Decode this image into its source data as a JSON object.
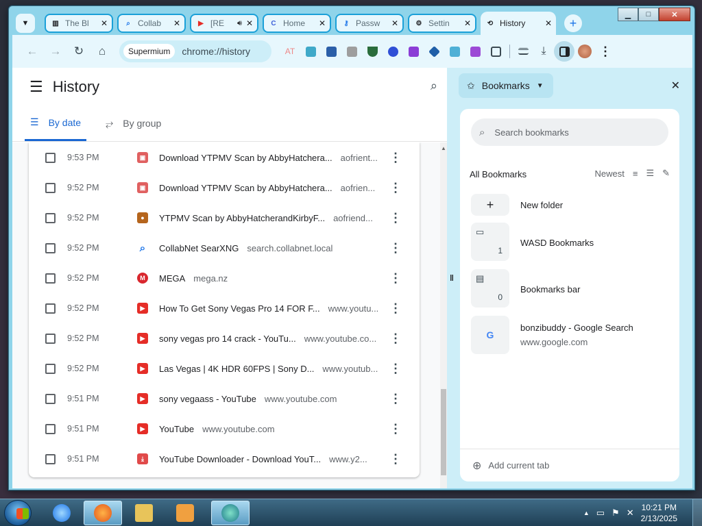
{
  "window": {
    "controls": {
      "minimize": "▁",
      "maximize": "□",
      "close": "✕"
    }
  },
  "tabs": [
    {
      "title": "The Bl",
      "icon": "library-icon",
      "color": "#202124"
    },
    {
      "title": "Collab",
      "icon": "search-icon",
      "color": "#1a73e8"
    },
    {
      "title": "[RE",
      "icon": "youtube-icon",
      "color": "#e52d27",
      "audio": true
    },
    {
      "title": "Home",
      "icon": "c-logo-icon",
      "color": "#3c5fd8"
    },
    {
      "title": "Passw",
      "icon": "key-icon",
      "color": "#1a73e8"
    },
    {
      "title": "Settin",
      "icon": "gear-icon",
      "color": "#202124"
    },
    {
      "title": "History",
      "icon": "history-icon",
      "color": "#202124",
      "active": true
    }
  ],
  "toolbar": {
    "site_chip": "Supermium",
    "url": "chrome://history"
  },
  "history": {
    "title": "History",
    "tabs": [
      "By date",
      "By group"
    ],
    "rows": [
      {
        "time": "9:53 PM",
        "title": "Download YTPMV Scan by AbbyHatchera...",
        "domain": "aofrient...",
        "icon": "archive-icon",
        "color": "#e06060"
      },
      {
        "time": "9:52 PM",
        "title": "Download YTPMV Scan by AbbyHatchera...",
        "domain": "aofrien...",
        "icon": "archive-icon",
        "color": "#e06060"
      },
      {
        "time": "9:52 PM",
        "title": "YTPMV Scan by AbbyHatcherandKirbyF...",
        "domain": "aofriend...",
        "icon": "cookie-icon",
        "color": "#b5651d"
      },
      {
        "time": "9:52 PM",
        "title": "CollabNet SearXNG",
        "domain": "search.collabnet.local",
        "icon": "search-icon",
        "color": "#1a73e8"
      },
      {
        "time": "9:52 PM",
        "title": "MEGA",
        "domain": "mega.nz",
        "icon": "mega-icon",
        "color": "#d9272e"
      },
      {
        "time": "9:52 PM",
        "title": "How To Get Sony Vegas Pro 14 FOR F...",
        "domain": "www.youtu...",
        "icon": "youtube-icon",
        "color": "#e52d27"
      },
      {
        "time": "9:52 PM",
        "title": "sony vegas pro 14 crack - YouTu...",
        "domain": "www.youtube.co...",
        "icon": "youtube-icon",
        "color": "#e52d27"
      },
      {
        "time": "9:52 PM",
        "title": "Las Vegas | 4K HDR 60FPS | Sony D...",
        "domain": "www.youtub...",
        "icon": "youtube-icon",
        "color": "#e52d27"
      },
      {
        "time": "9:51 PM",
        "title": "sony vegaass - YouTube",
        "domain": "www.youtube.com",
        "icon": "youtube-icon",
        "color": "#e52d27"
      },
      {
        "time": "9:51 PM",
        "title": "YouTube",
        "domain": "www.youtube.com",
        "icon": "youtube-icon",
        "color": "#e52d27"
      },
      {
        "time": "9:51 PM",
        "title": "YouTube Downloader - Download YouT...",
        "domain": "www.y2...",
        "icon": "download-icon",
        "color": "#e04a4a"
      }
    ]
  },
  "bookmarks": {
    "header": "Bookmarks",
    "search_placeholder": "Search bookmarks",
    "all_label": "All Bookmarks",
    "sort_label": "Newest",
    "new_folder": "New folder",
    "items": [
      {
        "name": "WASD Bookmarks",
        "count": "1",
        "icon": "folder-icon"
      },
      {
        "name": "Bookmarks bar",
        "count": "0",
        "icon": "bookmarks-bar-icon"
      },
      {
        "name": "bonzibuddy - Google Search",
        "url": "www.google.com",
        "icon": "google-icon"
      }
    ],
    "add_current_tab": "Add current tab"
  },
  "taskbar": {
    "time": "10:21 PM",
    "date": "2/13/2025"
  }
}
